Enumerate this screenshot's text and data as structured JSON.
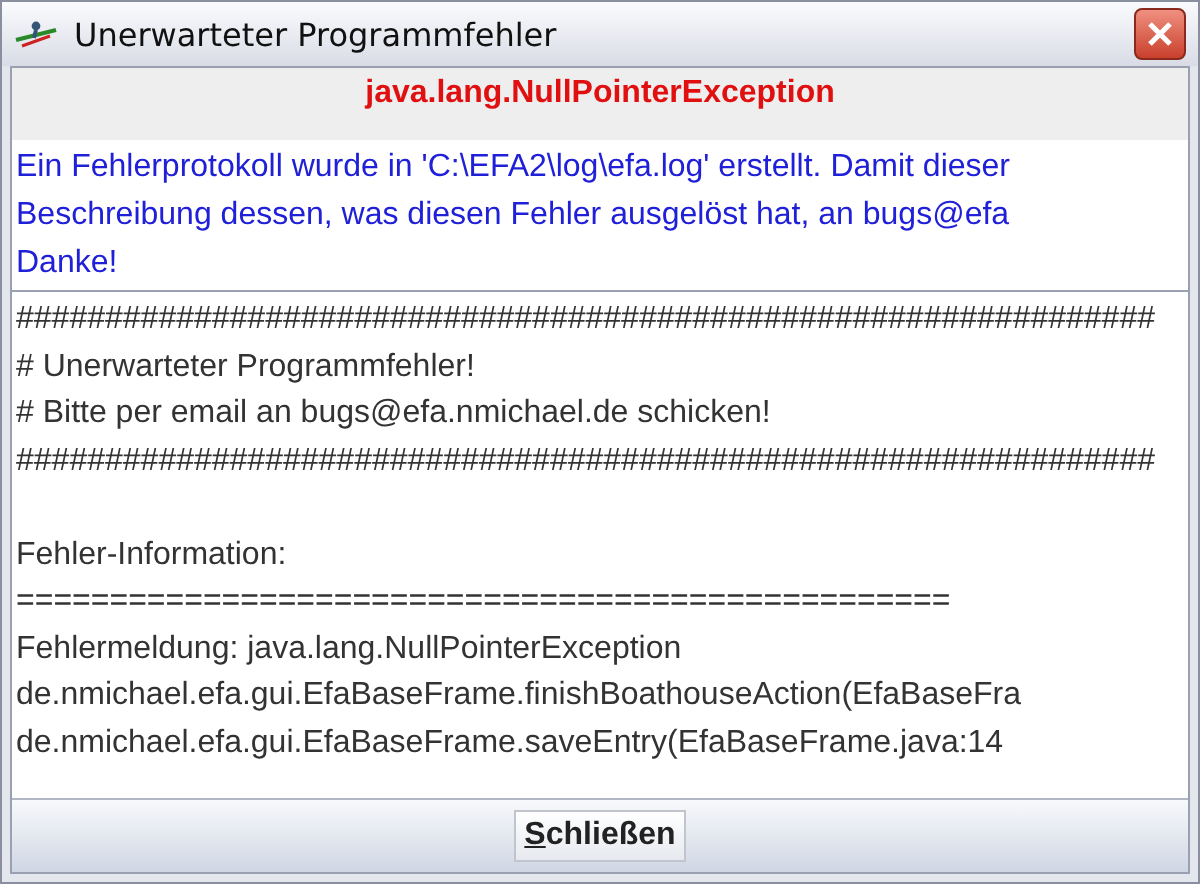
{
  "window": {
    "title": "Unerwarteter Programmfehler"
  },
  "header": {
    "exception": "java.lang.NullPointerException"
  },
  "message_lines": [
    "Ein Fehlerprotokoll wurde in 'C:\\EFA2\\log\\efa.log' erstellt. Damit dieser",
    "Beschreibung dessen, was diesen Fehler ausgelöst hat, an bugs@efa",
    "Danke!"
  ],
  "log_lines": [
    {
      "kind": "text",
      "text": "################################################################"
    },
    {
      "kind": "text",
      "text": "# Unerwarteter Programmfehler!"
    },
    {
      "kind": "text",
      "text": "# Bitte per email an bugs@efa.nmichael.de schicken!"
    },
    {
      "kind": "text",
      "text": "################################################################"
    },
    {
      "kind": "blank"
    },
    {
      "kind": "text",
      "text": "Fehler-Information:"
    },
    {
      "kind": "text",
      "text": "=================================================="
    },
    {
      "kind": "text",
      "text": "Fehlermeldung: java.lang.NullPointerException"
    },
    {
      "kind": "text",
      "text": "de.nmichael.efa.gui.EfaBaseFrame.finishBoathouseAction(EfaBaseFra"
    },
    {
      "kind": "text",
      "text": "de.nmichael.efa.gui.EfaBaseFrame.saveEntry(EfaBaseFrame.java:14"
    }
  ],
  "buttons": [
    {
      "label": "Schließen",
      "first_letter_underlined": true
    }
  ]
}
